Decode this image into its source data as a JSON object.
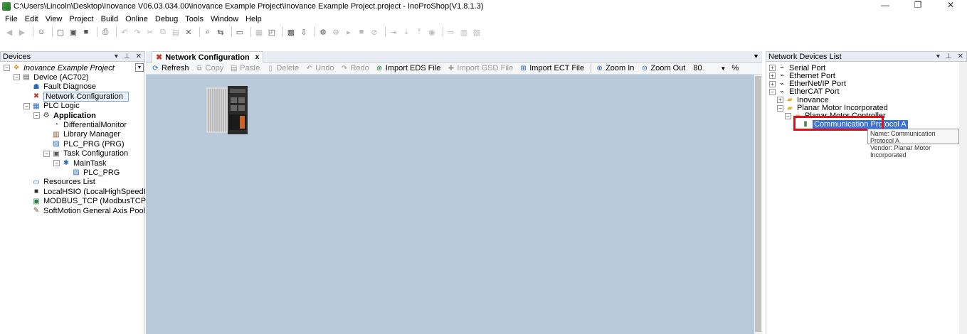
{
  "window": {
    "title": "C:\\Users\\Lincoln\\Desktop\\Inovance V06.03.034.00\\Inovance Example Project\\Inovance Example Project.project - InoProShop(V1.8.1.3)",
    "controls": [
      "—",
      "❐",
      "✕"
    ]
  },
  "menu": [
    "File",
    "Edit",
    "View",
    "Project",
    "Build",
    "Online",
    "Debug",
    "Tools",
    "Window",
    "Help"
  ],
  "devices_panel": {
    "title": "Devices",
    "tree": [
      {
        "label": "Inovance Example Project",
        "level": 0,
        "expander": "−",
        "icon": "project-icon",
        "italic": true
      },
      {
        "label": "Device (AC702)",
        "level": 1,
        "expander": "−",
        "icon": "device-icon"
      },
      {
        "label": "Fault Diagnose",
        "level": 2,
        "icon": "diagnose-icon"
      },
      {
        "label": "Network Configuration",
        "level": 2,
        "icon": "network-config-icon",
        "selected": true
      },
      {
        "label": "PLC Logic",
        "level": 2,
        "expander": "−",
        "icon": "plc-logic-icon"
      },
      {
        "label": "Application",
        "level": 3,
        "expander": "−",
        "icon": "application-icon",
        "bold": true
      },
      {
        "label": "DifferentialMonitor",
        "level": 4,
        "icon": "monitor-icon"
      },
      {
        "label": "Library Manager",
        "level": 4,
        "icon": "library-icon"
      },
      {
        "label": "PLC_PRG (PRG)",
        "level": 4,
        "icon": "program-icon"
      },
      {
        "label": "Task Configuration",
        "level": 4,
        "expander": "−",
        "icon": "task-config-icon"
      },
      {
        "label": "MainTask",
        "level": 5,
        "expander": "−",
        "icon": "task-icon"
      },
      {
        "label": "PLC_PRG",
        "level": 6,
        "icon": "program-call-icon"
      },
      {
        "label": "Resources List",
        "level": 2,
        "icon": "resources-icon"
      },
      {
        "label": "LocalHSIO (LocalHighSpeedIO)",
        "level": 2,
        "icon": "hsio-icon"
      },
      {
        "label": "MODBUS_TCP (ModbusTCP Dev...",
        "level": 2,
        "icon": "modbus-icon"
      },
      {
        "label": "SoftMotion General Axis Pool",
        "level": 2,
        "icon": "axis-pool-icon"
      }
    ]
  },
  "editor": {
    "tab_label": "Network Configuration",
    "tab_close": "x",
    "toolbar": {
      "refresh": "Refresh",
      "copy": "Copy",
      "paste": "Paste",
      "delete": "Delete",
      "undo": "Undo",
      "redo": "Redo",
      "import_eds": "Import EDS File",
      "import_gsd": "Import GSD File",
      "import_ect": "Import ECT File",
      "zoom_in": "Zoom In",
      "zoom_out": "Zoom Out",
      "zoom_value": "80",
      "zoom_unit": "%"
    }
  },
  "network_panel": {
    "title": "Network Devices List",
    "tree": [
      {
        "label": "Serial Port",
        "level": 0,
        "expander": "+",
        "icon": "port-icon"
      },
      {
        "label": "Ethernet Port",
        "level": 0,
        "expander": "+",
        "icon": "port-icon"
      },
      {
        "label": "EtherNet/IP Port",
        "level": 0,
        "expander": "+",
        "icon": "port-icon"
      },
      {
        "label": "EtherCAT Port",
        "level": 0,
        "expander": "−",
        "icon": "port-icon"
      },
      {
        "label": "Inovance",
        "level": 1,
        "expander": "+",
        "icon": "folder-icon"
      },
      {
        "label": "Planar Motor Incorporated",
        "level": 1,
        "expander": "−",
        "icon": "folder-icon"
      },
      {
        "label": "Planar Motor Controller",
        "level": 2,
        "expander": "−",
        "icon": "folder-icon"
      },
      {
        "label": "Communication Protocol A",
        "level": 3,
        "icon": "device-module-icon",
        "selected": true
      }
    ],
    "tooltip": {
      "name": "Name: Communication Protocol A",
      "vendor": "Vendor: Planar Motor Incorporated"
    }
  },
  "colors": {
    "canvas_bg": "#b8c9d9",
    "highlight": "#e0101a",
    "selection": "#3a73d6"
  }
}
